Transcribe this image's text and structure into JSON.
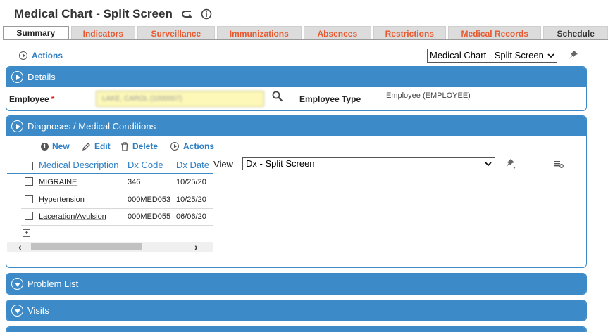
{
  "page": {
    "title": "Medical Chart - Split Screen",
    "back_icon": "return-arrow-icon",
    "info_icon": "info-icon"
  },
  "tabs": [
    {
      "label": "Summary",
      "active": true
    },
    {
      "label": "Indicators"
    },
    {
      "label": "Surveillance"
    },
    {
      "label": "Immunizations"
    },
    {
      "label": "Absences"
    },
    {
      "label": "Restrictions"
    },
    {
      "label": "Medical Records"
    },
    {
      "label": "Schedule"
    }
  ],
  "top_actions": {
    "label": "Actions"
  },
  "view_selector": {
    "value": "Medical Chart - Split Screen"
  },
  "details": {
    "title": "Details",
    "employee_label": "Employee",
    "required_mark": "*",
    "employee_value": "LAKE, CAROL (1000007)",
    "employee_type_label": "Employee Type",
    "employee_type_value": "Employee (EMPLOYEE)"
  },
  "diagnoses": {
    "title": "Diagnoses / Medical Conditions",
    "toolbar": {
      "new": "New",
      "edit": "Edit",
      "delete": "Delete",
      "actions": "Actions"
    },
    "columns": [
      "Medical Description",
      "Dx Code",
      "Dx Date"
    ],
    "rows": [
      {
        "description": "MIGRAINE",
        "code": "346",
        "date": "10/25/20"
      },
      {
        "description": "Hypertension",
        "code": "000MED053",
        "date": "10/25/20"
      },
      {
        "description": "Laceration/Avulsion",
        "code": "000MED055",
        "date": "06/06/20"
      }
    ],
    "view_label": "View",
    "view_value": "Dx - Split Screen"
  },
  "problem_list": {
    "title": "Problem List"
  },
  "visits": {
    "title": "Visits"
  },
  "colors": {
    "accent": "#3c8bc8",
    "tab_text": "#e8592f",
    "link": "#2d7fc4"
  }
}
